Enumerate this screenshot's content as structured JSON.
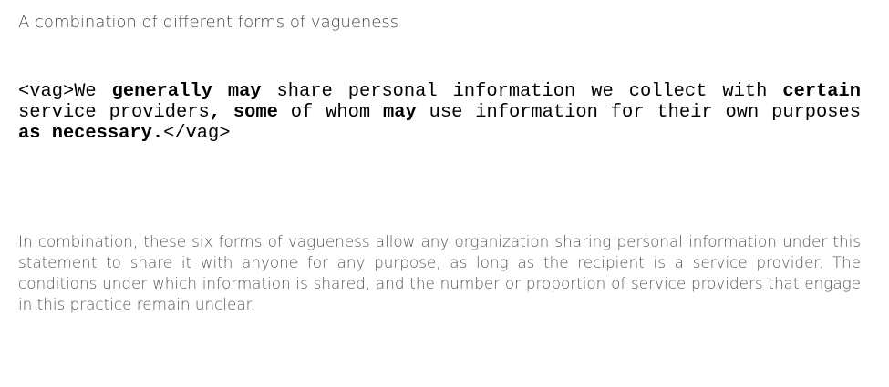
{
  "heading": "A combination of different forms of vagueness",
  "example": {
    "open_tag": "<vag>",
    "segments": [
      {
        "text": "We ",
        "bold": false
      },
      {
        "text": "generally",
        "bold": true
      },
      {
        "text": " ",
        "bold": false
      },
      {
        "text": "may",
        "bold": true
      },
      {
        "text": " share personal information we collect with ",
        "bold": false
      },
      {
        "text": "certain",
        "bold": true
      },
      {
        "text": " service providers",
        "bold": false
      },
      {
        "text": ",",
        "bold": true
      },
      {
        "text": " ",
        "bold": false
      },
      {
        "text": "some",
        "bold": true
      },
      {
        "text": " of whom ",
        "bold": false
      },
      {
        "text": "may",
        "bold": true
      },
      {
        "text": " use information for their own purposes ",
        "bold": false
      },
      {
        "text": "as necessary.",
        "bold": true
      }
    ],
    "close_tag": "</vag>"
  },
  "explanation": "In combination, these six forms of vagueness allow any organization sharing personal information under this statement to share it with anyone for any purpose, as long as the recipient is a service provider.  The conditions under which information is shared, and the number or proportion of service providers that engage in this practice remain unclear."
}
